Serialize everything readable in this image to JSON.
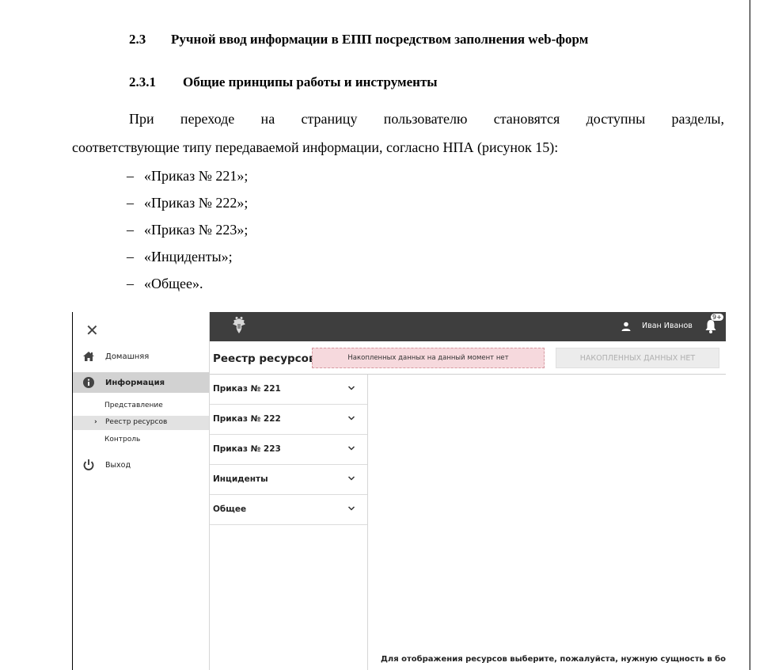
{
  "document": {
    "heading_2": {
      "number": "2.3",
      "text": "Ручной ввод информации в ЕПП посредством заполнения web-форм"
    },
    "heading_3": {
      "number": "2.3.1",
      "text": "Общие принципы работы и инструменты"
    },
    "paragraph_line1": "При переходе на страницу пользователю становятся доступны разделы,",
    "paragraph_line2": "соответствующие типу передаваемой информации, согласно НПА (рисунок 15):",
    "list": [
      {
        "dash": "–",
        "text": "«Приказ № 221»;"
      },
      {
        "dash": "–",
        "text": "«Приказ № 222»;"
      },
      {
        "dash": "–",
        "text": "«Приказ № 223»;"
      },
      {
        "dash": "–",
        "text": "«Инциденты»;"
      },
      {
        "dash": "–",
        "text": "«Общее»."
      }
    ]
  },
  "screenshot": {
    "sidebar": {
      "close_glyph": "✕",
      "items": [
        {
          "label": "Домашняя",
          "icon": "home-icon"
        },
        {
          "label": "Информация",
          "icon": "info-icon"
        },
        {
          "label": "Выход",
          "icon": "power-icon"
        }
      ],
      "subitems": [
        {
          "label": "Представление"
        },
        {
          "label": "Реестр ресурсов",
          "chevron": "›"
        },
        {
          "label": "Контроль"
        }
      ]
    },
    "topbar": {
      "emblem": "emblem-icon",
      "user_name": "Иван Иванов",
      "notification_badge": "9+"
    },
    "main": {
      "title": "Реестр ресурсов",
      "alert_text": "Накопленных данных на данный момент нет",
      "status_button": "НАКОПЛЕННЫХ ДАННЫХ НЕТ",
      "accordion": [
        {
          "label": "Приказ № 221"
        },
        {
          "label": "Приказ № 222"
        },
        {
          "label": "Приказ № 223"
        },
        {
          "label": "Инциденты"
        },
        {
          "label": "Общее"
        }
      ],
      "hint": "Для отображения ресурсов выберите, пожалуйста, нужную сущность в боковом"
    },
    "colors": {
      "topbar": "#3e3e3e",
      "active_nav": "#d2d2d2",
      "alert_bg": "#f6d9dd",
      "status_btn_bg": "#ececec"
    }
  }
}
